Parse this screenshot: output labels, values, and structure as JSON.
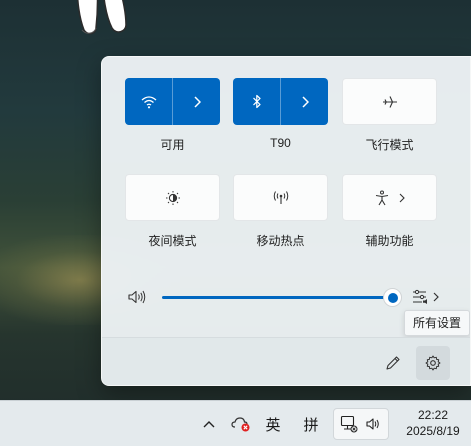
{
  "quick_settings": {
    "tiles": [
      {
        "label": "可用",
        "icon": "wifi-icon",
        "active": true
      },
      {
        "label": "T90",
        "icon": "bluetooth-icon",
        "active": true
      },
      {
        "label": "飞行模式",
        "icon": "airplane-icon",
        "active": false
      },
      {
        "label": "夜间模式",
        "icon": "night-light-icon",
        "active": false
      },
      {
        "label": "移动热点",
        "icon": "hotspot-icon",
        "active": false
      },
      {
        "label": "辅助功能",
        "icon": "accessibility-icon",
        "active": false
      }
    ],
    "volume": {
      "icon": "speaker-icon",
      "level": 1.0
    },
    "audio_settings_tooltip": "所有设置"
  },
  "taskbar": {
    "ime_lang": "英",
    "ime_mode": "拼",
    "time": "22:22",
    "date": "2025/8/19"
  },
  "colors": {
    "accent": "#0067c0",
    "panel_bg": "#ecf2f4",
    "taskbar_bg": "#e4eaed"
  }
}
